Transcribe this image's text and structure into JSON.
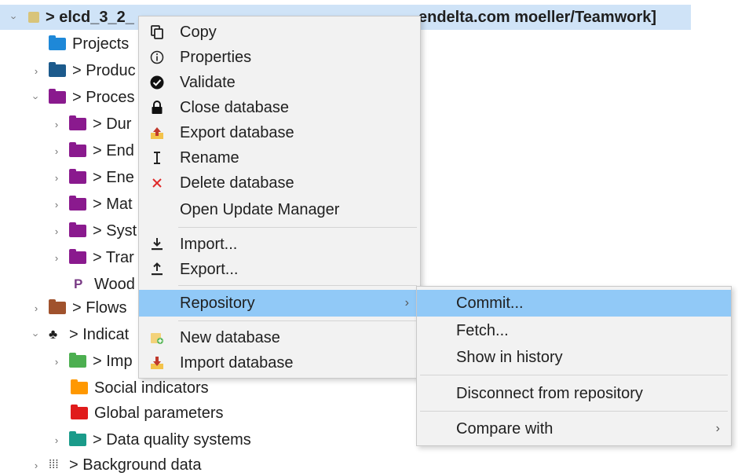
{
  "tree": {
    "root_label": "> elcd_3_2_",
    "root_label_tail": "endelta.com moeller/Teamwork]",
    "items": [
      {
        "label": "Projects"
      },
      {
        "label": "> Produc"
      },
      {
        "label": "> Proces"
      },
      {
        "label": "> Dur"
      },
      {
        "label": "> End"
      },
      {
        "label": "> Ene"
      },
      {
        "label": "> Mat"
      },
      {
        "label": "> Syst"
      },
      {
        "label": "> Trar"
      },
      {
        "label": "Wood"
      },
      {
        "label": "> Flows"
      },
      {
        "label": "> Indicat"
      },
      {
        "label": "> Imp"
      },
      {
        "label": "Social indicators"
      },
      {
        "label": "Global parameters"
      },
      {
        "label": "> Data quality systems"
      },
      {
        "label": "> Background data"
      }
    ]
  },
  "context_menu": {
    "items": [
      {
        "label": "Copy",
        "icon": "copy-icon"
      },
      {
        "label": "Properties",
        "icon": "info-icon"
      },
      {
        "label": "Validate",
        "icon": "check-circle-icon"
      },
      {
        "label": "Close database",
        "icon": "lock-icon"
      },
      {
        "label": "Export database",
        "icon": "export-database-icon"
      },
      {
        "label": "Rename",
        "icon": "rename-icon"
      },
      {
        "label": "Delete database",
        "icon": "delete-icon"
      },
      {
        "label": "Open Update Manager",
        "icon": ""
      },
      {
        "label": "Import...",
        "icon": "import-icon"
      },
      {
        "label": "Export...",
        "icon": "export-icon"
      },
      {
        "label": "Repository",
        "icon": ""
      },
      {
        "label": "New database",
        "icon": "new-database-icon"
      },
      {
        "label": "Import database",
        "icon": "import-database-icon"
      }
    ],
    "submenu_arrow": "›"
  },
  "submenu": {
    "items": [
      {
        "label": "Commit..."
      },
      {
        "label": "Fetch..."
      },
      {
        "label": "Show in history"
      },
      {
        "label": "Disconnect from repository"
      },
      {
        "label": "Compare with"
      }
    ],
    "submenu_arrow": "›"
  },
  "colors": {
    "selection": "#cfe3f7",
    "menu_hover": "#91c9f7",
    "menu_bg": "#f2f2f2",
    "folder_blue": "#1e88d8",
    "folder_navy": "#1c5a8c",
    "folder_purple": "#8a1a8e",
    "folder_brown": "#a0522d",
    "folder_green": "#4caf50",
    "folder_orange": "#ff9800",
    "folder_red": "#e01b1b",
    "folder_teal": "#1a9b8a",
    "delete_red": "#e02b2b"
  }
}
